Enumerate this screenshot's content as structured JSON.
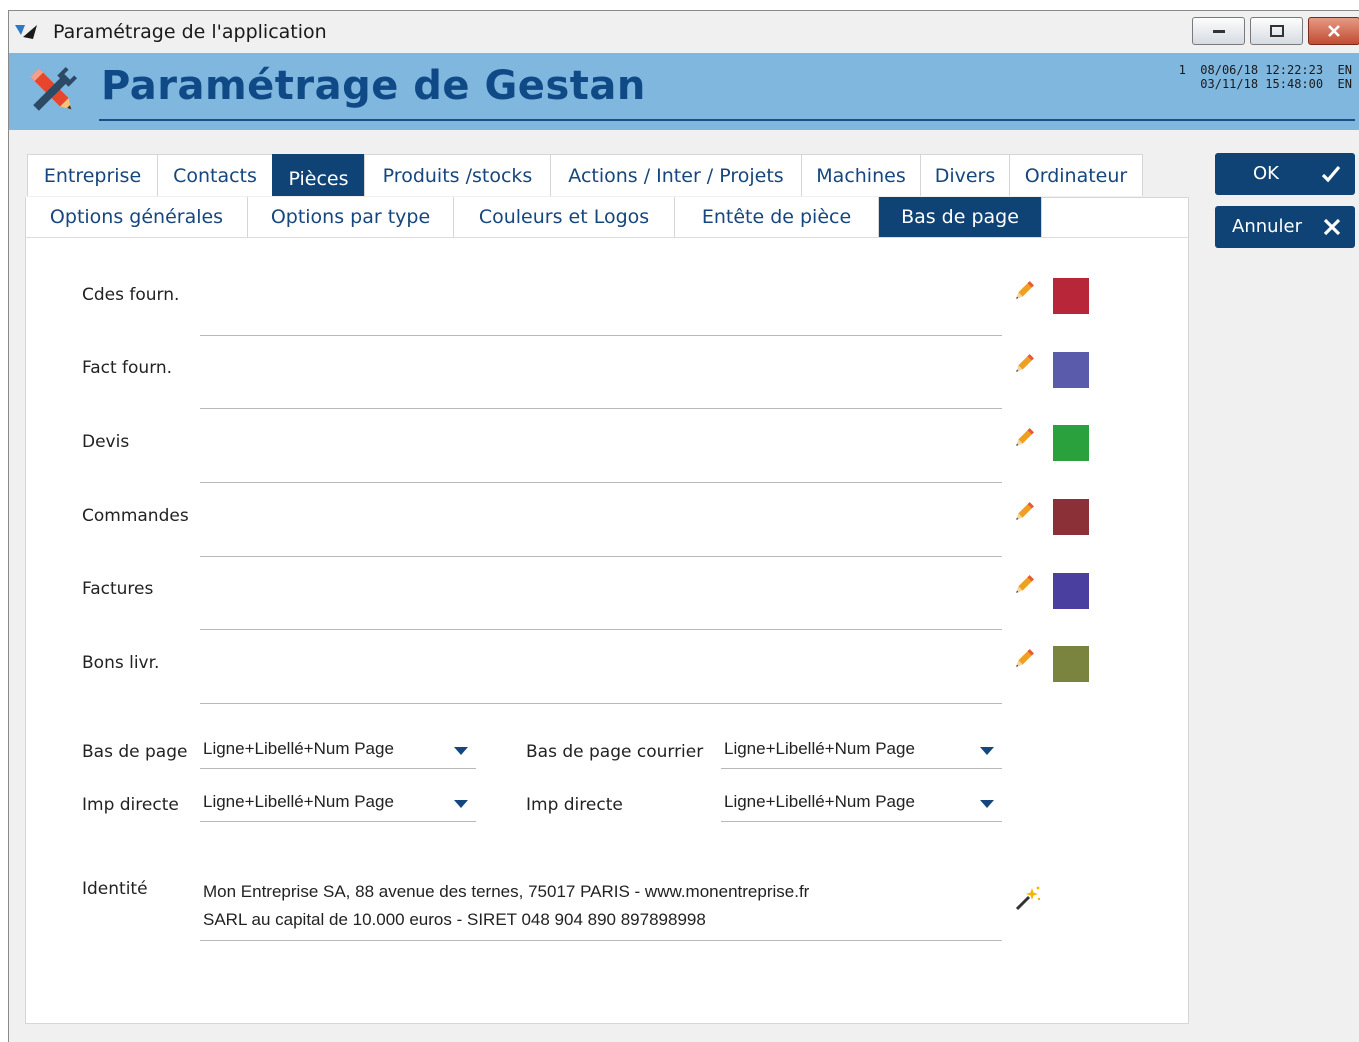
{
  "window": {
    "title": "Paramétrage de l'application"
  },
  "banner": {
    "title": "Paramétrage de Gestan",
    "info_line1": "1  08/06/18 12:22:23  EN",
    "info_line2": "03/11/18 15:48:00  EN"
  },
  "tabs_main": [
    {
      "label": "Entreprise",
      "active": false
    },
    {
      "label": "Contacts",
      "active": false
    },
    {
      "label": "Pièces",
      "active": true
    },
    {
      "label": "Produits /stocks",
      "active": false
    },
    {
      "label": "Actions / Inter / Projets",
      "active": false
    },
    {
      "label": "Machines",
      "active": false
    },
    {
      "label": "Divers",
      "active": false
    },
    {
      "label": "Ordinateur",
      "active": false
    }
  ],
  "tabs_sub": [
    {
      "label": "Options générales",
      "active": false
    },
    {
      "label": "Options par type",
      "active": false
    },
    {
      "label": "Couleurs et Logos",
      "active": false
    },
    {
      "label": "Entête de pièce",
      "active": false
    },
    {
      "label": "Bas de page",
      "active": true
    }
  ],
  "buttons": {
    "ok": "OK",
    "cancel": "Annuler"
  },
  "rows": [
    {
      "label": "Cdes fourn.",
      "value": "",
      "color": "#b8263a"
    },
    {
      "label": "Fact fourn.",
      "value": "",
      "color": "#5b5bab"
    },
    {
      "label": "Devis",
      "value": "",
      "color": "#2aa13c"
    },
    {
      "label": "Commandes",
      "value": "",
      "color": "#8c3038"
    },
    {
      "label": "Factures",
      "value": "",
      "color": "#4a3f9e"
    },
    {
      "label": "Bons livr.",
      "value": "",
      "color": "#7a843f"
    }
  ],
  "footer_options": {
    "bas_de_page_label": "Bas de page",
    "bas_de_page_value": "Ligne+Libellé+Num Page",
    "bas_de_page_courrier_label": "Bas de page courrier",
    "bas_de_page_courrier_value": "Ligne+Libellé+Num Page",
    "imp_directe_label": "Imp directe",
    "imp_directe_value": "Ligne+Libellé+Num Page",
    "imp_directe_courrier_label": "Imp directe",
    "imp_directe_courrier_value": "Ligne+Libellé+Num Page"
  },
  "identity": {
    "label": "Identité",
    "line1": "Mon Entreprise SA, 88 avenue des ternes, 75017 PARIS - www.monentreprise.fr",
    "line2": "SARL au capital de 10.000 euros - SIRET 048 904 890 897898998"
  },
  "icons": {
    "edit": "pencil-icon",
    "generate": "magic-wand-icon",
    "dropdown": "caret-down-icon",
    "ok": "check-icon",
    "cancel": "x-icon"
  }
}
